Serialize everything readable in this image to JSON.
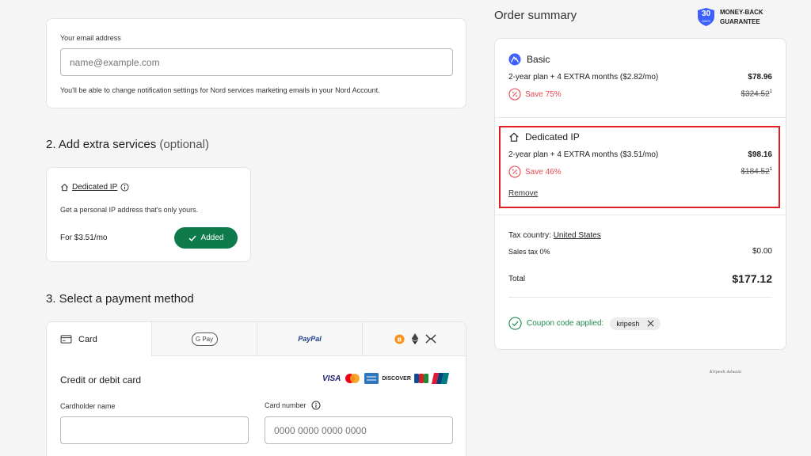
{
  "email_section": {
    "email_label": "Your email address",
    "email_placeholder": "name@example.com",
    "email_note": "You'll be able to change notification settings for Nord services marketing emails in your Nord Account."
  },
  "extras_section": {
    "title": "2. Add extra services",
    "title_optional": "(optional)",
    "service_name": "Dedicated IP",
    "service_description": "Get a personal IP address that's only yours.",
    "price": "For $3.51/mo",
    "added_label": "Added"
  },
  "payment_section": {
    "title": "3. Select a payment method",
    "tabs": [
      {
        "label": "Card",
        "icon": "card-icon",
        "active": true
      },
      {
        "label": "G Pay",
        "icon": "google-pay-logo",
        "active": false
      },
      {
        "label": "PayPal",
        "icon": "paypal-logo",
        "active": false
      },
      {
        "label": "",
        "icon": "crypto-icons",
        "active": false
      }
    ],
    "heading": "Credit or debit card",
    "card_brands": [
      "VISA",
      "DISCOVER"
    ],
    "cardholder_label": "Cardholder name",
    "card_number_label": "Card number",
    "card_number_placeholder": "0000 0000 0000 0000"
  },
  "order_summary": {
    "title": "Order summary",
    "guarantee_days": "30",
    "guarantee_days_label": "DAYS",
    "guarantee_line1": "MONEY-BACK",
    "guarantee_line2": "GUARANTEE",
    "basic": {
      "name": "Basic",
      "plan": "2-year plan + 4 EXTRA months ($2.82/mo)",
      "price": "$78.96",
      "save": "Save 75%",
      "old_price": "$324.52",
      "footnote": "1"
    },
    "dedicated_ip": {
      "name": "Dedicated IP",
      "plan": "2-year plan + 4 EXTRA months ($3.51/mo)",
      "price": "$98.16",
      "save": "Save 46%",
      "old_price": "$184.52",
      "footnote": "1",
      "remove_label": "Remove"
    },
    "tax_country_label": "Tax country:",
    "tax_country": "United States",
    "sales_tax_label": "Sales tax 0%",
    "sales_tax_value": "$0.00",
    "total_label": "Total",
    "total_value": "$177.12",
    "coupon_label": "Coupon code applied:",
    "coupon_code": "kripesh"
  },
  "signature": "Kripesh Adwani",
  "colors": {
    "accent_green": "#0f7a4c",
    "save_red": "#e5484d",
    "highlight_red": "#e11d23",
    "nord_blue": "#3e5fff",
    "coupon_green": "#1f8a4c"
  }
}
